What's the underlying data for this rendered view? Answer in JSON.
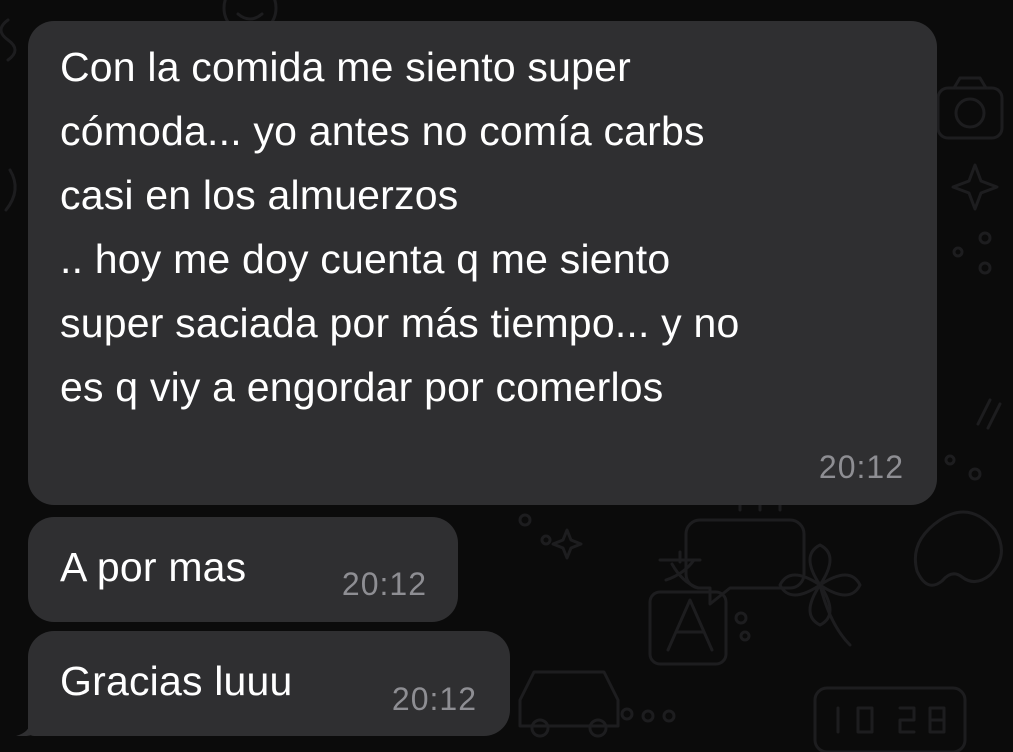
{
  "colors": {
    "background": "#0b0b0b",
    "bubble_incoming": "#2f2f31",
    "text": "#ffffff",
    "timestamp": "#8e8e93",
    "wallpaper_doodle": "#1d1d1f"
  },
  "messages": [
    {
      "direction": "incoming",
      "text": "Con la comida me siento super\ncómoda... yo antes no comía carbs\ncasi en los almuerzos\n.. hoy me doy cuenta q me siento\nsuper saciada por más tiempo... y no\nes q viy a engordar por comerlos",
      "time": "20:12"
    },
    {
      "direction": "incoming",
      "text": "A por mas",
      "time": "20:12"
    },
    {
      "direction": "incoming",
      "text": "Gracias luuu",
      "time": "20:12"
    }
  ],
  "wallpaper_icons": [
    "camera-icon",
    "sparkle-icon",
    "translate-icon",
    "clover-icon",
    "car-icon",
    "clock-icon",
    "smiley-icon",
    "chat-bubble-icon",
    "palette-icon"
  ]
}
